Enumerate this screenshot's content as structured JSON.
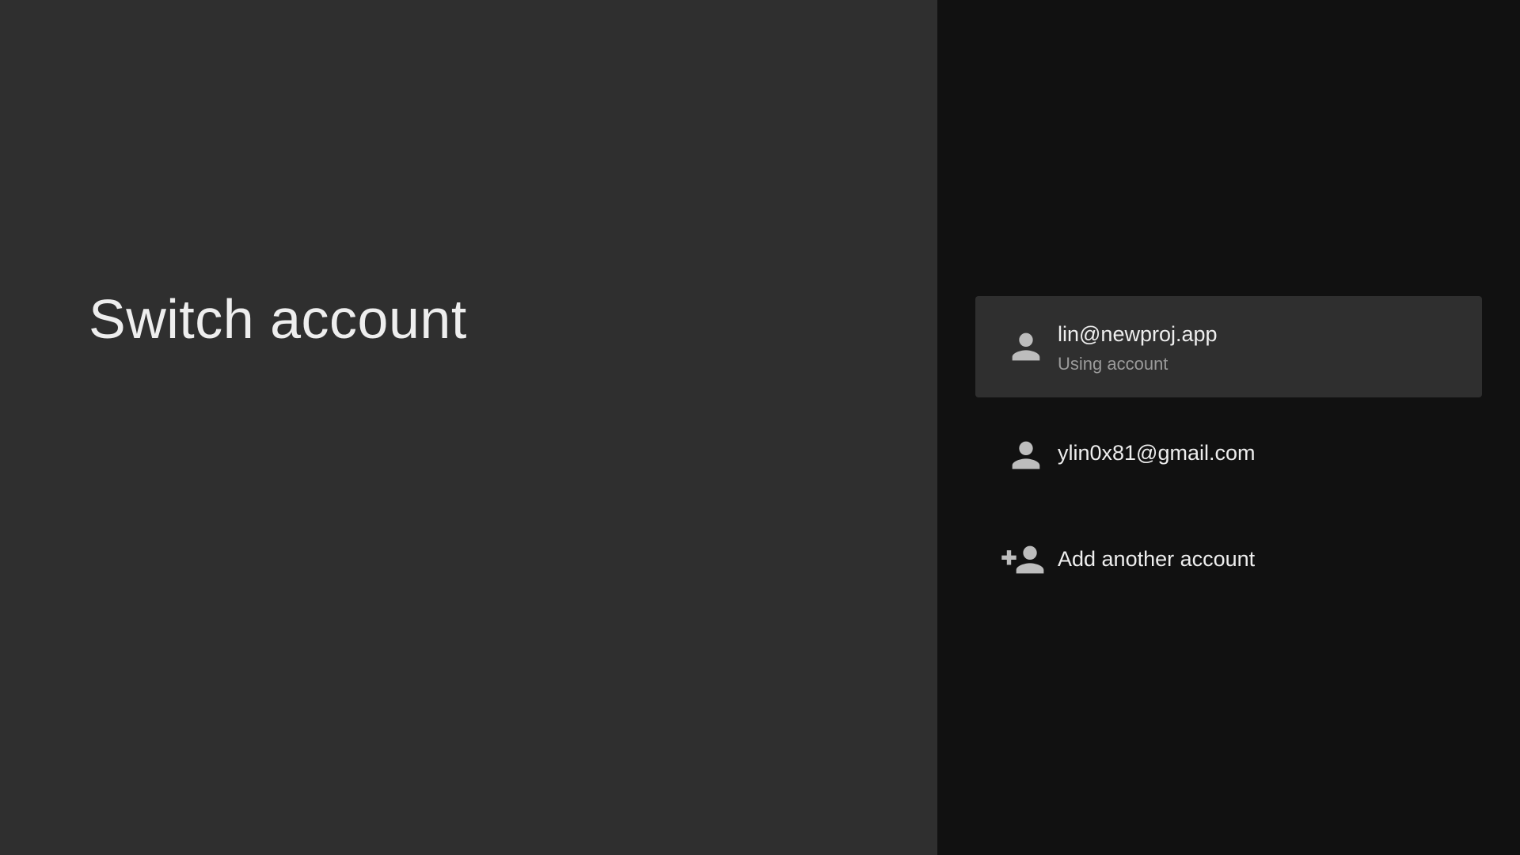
{
  "page": {
    "title": "Switch account"
  },
  "accounts": [
    {
      "email": "lin@newproj.app",
      "status": "Using account",
      "icon": "person-icon",
      "selected": true
    },
    {
      "email": "ylin0x81@gmail.com",
      "icon": "person-icon",
      "selected": false
    }
  ],
  "actions": {
    "add_account_label": "Add another account",
    "add_account_icon": "person-add-icon"
  },
  "colors": {
    "left_panel_bg": "#2f2f2f",
    "right_panel_bg": "#111111",
    "selected_item_bg": "#2f2f2f",
    "primary_text": "#eeeeee",
    "secondary_text": "#9a9a9a",
    "icon": "#bdbdbd"
  }
}
